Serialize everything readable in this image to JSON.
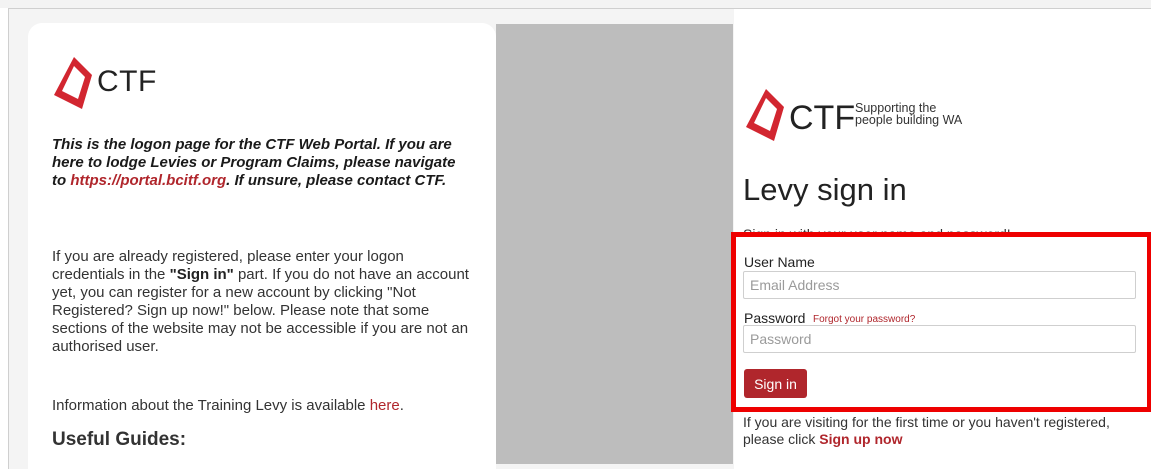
{
  "left_panel": {
    "logo_text": "CTF",
    "intro": {
      "part1": "This is the logon page for the CTF Web Portal. If you are here to lodge Levies or Program Claims, please navigate to ",
      "link": "https://portal.bcitf.org",
      "part2": ". If unsure, please contact CTF."
    },
    "para1": {
      "part1": "If you are already registered, please enter your logon credentials in the ",
      "bold": "\"Sign in\"",
      "part2": " part. If you do not have an account yet, you can register for a new account by clicking \"Not Registered? Sign up now!\" below. Please note that some sections of the website may not be accessible if you are not an authorised user."
    },
    "para2": {
      "text": "Information about the Training Levy is available ",
      "link": "here",
      "end": "."
    },
    "guides_heading": "Useful Guides:"
  },
  "right_panel": {
    "logo_text": "CTF",
    "tagline_line1": "Supporting the",
    "tagline_line2": "people building WA",
    "title": "Levy sign in",
    "hint": "Sign in with your user name and password!",
    "username_label": "User Name",
    "username_placeholder": "Email Address",
    "password_label": "Password",
    "forgot_link": "Forgot your password?",
    "password_placeholder": "Password",
    "signin_button": "Sign in",
    "visit_text": "If you are visiting for the first time or you haven't registered, please click ",
    "signup_link": "Sign up now"
  },
  "colors": {
    "brand_red": "#b0262c",
    "highlight_red": "#ee0000",
    "gray_column": "#bdbdbd"
  }
}
